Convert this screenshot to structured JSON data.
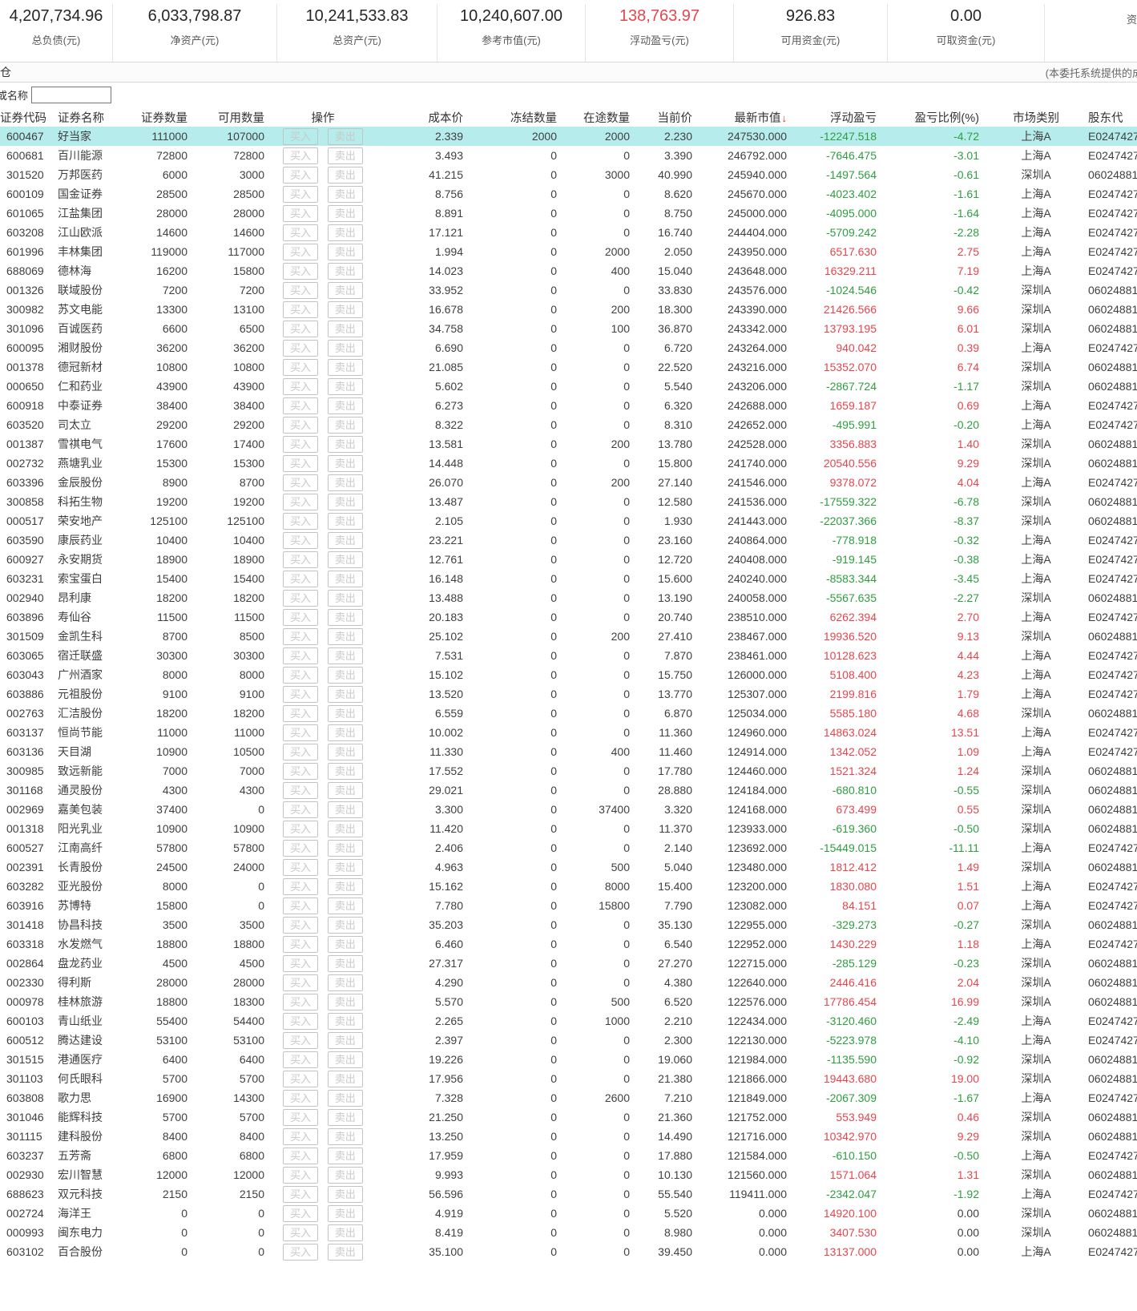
{
  "summary": {
    "items": [
      {
        "value": "4,207,734.96",
        "label": "总负债(元)"
      },
      {
        "value": "6,033,798.87",
        "label": "净资产(元)"
      },
      {
        "value": "10,241,533.83",
        "label": "总资产(元)"
      },
      {
        "value": "10,240,607.00",
        "label": "参考市值(元)"
      },
      {
        "value": "138,763.97",
        "label": "浮动盈亏(元)",
        "color": "#e5464e"
      },
      {
        "value": "926.83",
        "label": "可用资金(元)"
      },
      {
        "value": "0.00",
        "label": "可取资金(元)"
      },
      {
        "value": "",
        "label": "资"
      }
    ]
  },
  "tabbar": {
    "tab_label": "仓",
    "system_note": "(本委托系统提供的成"
  },
  "filter": {
    "label_fragment": "或",
    "label": "名称",
    "value": "",
    "placeholder": ""
  },
  "table": {
    "columns": [
      "证券代码",
      "证券名称",
      "证券数量",
      "可用数量",
      "操作",
      "成本价",
      "冻结数量",
      "在途数量",
      "当前价",
      "最新市值",
      "浮动盈亏",
      "盈亏比例(%)",
      "市场类别",
      "股东代"
    ],
    "sort_icon": "↓",
    "op": {
      "buy_label": "买入",
      "sell_label": "卖出"
    },
    "selected_row_index": 0,
    "colors": {
      "positive": "#e5464e",
      "negative": "#2e9e41",
      "selected_row": "#b7ecec"
    },
    "rows": [
      [
        "600467",
        "好当家",
        "111000",
        "107000",
        "2.339",
        "2000",
        "2000",
        "2.230",
        "247530.000",
        "-12247.518",
        "-4.72",
        "上海A",
        "E0247427"
      ],
      [
        "600681",
        "百川能源",
        "72800",
        "72800",
        "3.493",
        "0",
        "0",
        "3.390",
        "246792.000",
        "-7646.475",
        "-3.01",
        "上海A",
        "E0247427"
      ],
      [
        "301520",
        "万邦医药",
        "6000",
        "3000",
        "41.215",
        "0",
        "3000",
        "40.990",
        "245940.000",
        "-1497.564",
        "-0.61",
        "深圳A",
        "06024881"
      ],
      [
        "600109",
        "国金证券",
        "28500",
        "28500",
        "8.756",
        "0",
        "0",
        "8.620",
        "245670.000",
        "-4023.402",
        "-1.61",
        "上海A",
        "E0247427"
      ],
      [
        "601065",
        "江盐集团",
        "28000",
        "28000",
        "8.891",
        "0",
        "0",
        "8.750",
        "245000.000",
        "-4095.000",
        "-1.64",
        "上海A",
        "E0247427"
      ],
      [
        "603208",
        "江山欧派",
        "14600",
        "14600",
        "17.121",
        "0",
        "0",
        "16.740",
        "244404.000",
        "-5709.242",
        "-2.28",
        "上海A",
        "E0247427"
      ],
      [
        "601996",
        "丰林集团",
        "119000",
        "117000",
        "1.994",
        "0",
        "2000",
        "2.050",
        "243950.000",
        "6517.630",
        "2.75",
        "上海A",
        "E0247427"
      ],
      [
        "688069",
        "德林海",
        "16200",
        "15800",
        "14.023",
        "0",
        "400",
        "15.040",
        "243648.000",
        "16329.211",
        "7.19",
        "上海A",
        "E0247427"
      ],
      [
        "001326",
        "联域股份",
        "7200",
        "7200",
        "33.952",
        "0",
        "0",
        "33.830",
        "243576.000",
        "-1024.546",
        "-0.42",
        "深圳A",
        "06024881"
      ],
      [
        "300982",
        "苏文电能",
        "13300",
        "13100",
        "16.678",
        "0",
        "200",
        "18.300",
        "243390.000",
        "21426.566",
        "9.66",
        "深圳A",
        "06024881"
      ],
      [
        "301096",
        "百诚医药",
        "6600",
        "6500",
        "34.758",
        "0",
        "100",
        "36.870",
        "243342.000",
        "13793.195",
        "6.01",
        "深圳A",
        "06024881"
      ],
      [
        "600095",
        "湘财股份",
        "36200",
        "36200",
        "6.690",
        "0",
        "0",
        "6.720",
        "243264.000",
        "940.042",
        "0.39",
        "上海A",
        "E0247427"
      ],
      [
        "001378",
        "德冠新材",
        "10800",
        "10800",
        "21.085",
        "0",
        "0",
        "22.520",
        "243216.000",
        "15352.070",
        "6.74",
        "深圳A",
        "06024881"
      ],
      [
        "000650",
        "仁和药业",
        "43900",
        "43900",
        "5.602",
        "0",
        "0",
        "5.540",
        "243206.000",
        "-2867.724",
        "-1.17",
        "深圳A",
        "06024881"
      ],
      [
        "600918",
        "中泰证券",
        "38400",
        "38400",
        "6.273",
        "0",
        "0",
        "6.320",
        "242688.000",
        "1659.187",
        "0.69",
        "上海A",
        "E0247427"
      ],
      [
        "603520",
        "司太立",
        "29200",
        "29200",
        "8.322",
        "0",
        "0",
        "8.310",
        "242652.000",
        "-495.991",
        "-0.20",
        "上海A",
        "E0247427"
      ],
      [
        "001387",
        "雪祺电气",
        "17600",
        "17400",
        "13.581",
        "0",
        "200",
        "13.780",
        "242528.000",
        "3356.883",
        "1.40",
        "深圳A",
        "06024881"
      ],
      [
        "002732",
        "燕塘乳业",
        "15300",
        "15300",
        "14.448",
        "0",
        "0",
        "15.800",
        "241740.000",
        "20540.556",
        "9.29",
        "深圳A",
        "06024881"
      ],
      [
        "603396",
        "金辰股份",
        "8900",
        "8700",
        "26.070",
        "0",
        "200",
        "27.140",
        "241546.000",
        "9378.072",
        "4.04",
        "上海A",
        "E0247427"
      ],
      [
        "300858",
        "科拓生物",
        "19200",
        "19200",
        "13.487",
        "0",
        "0",
        "12.580",
        "241536.000",
        "-17559.322",
        "-6.78",
        "深圳A",
        "06024881"
      ],
      [
        "000517",
        "荣安地产",
        "125100",
        "125100",
        "2.105",
        "0",
        "0",
        "1.930",
        "241443.000",
        "-22037.366",
        "-8.37",
        "深圳A",
        "06024881"
      ],
      [
        "603590",
        "康辰药业",
        "10400",
        "10400",
        "23.221",
        "0",
        "0",
        "23.160",
        "240864.000",
        "-778.918",
        "-0.32",
        "上海A",
        "E0247427"
      ],
      [
        "600927",
        "永安期货",
        "18900",
        "18900",
        "12.761",
        "0",
        "0",
        "12.720",
        "240408.000",
        "-919.145",
        "-0.38",
        "上海A",
        "E0247427"
      ],
      [
        "603231",
        "索宝蛋白",
        "15400",
        "15400",
        "16.148",
        "0",
        "0",
        "15.600",
        "240240.000",
        "-8583.344",
        "-3.45",
        "上海A",
        "E0247427"
      ],
      [
        "002940",
        "昂利康",
        "18200",
        "18200",
        "13.488",
        "0",
        "0",
        "13.190",
        "240058.000",
        "-5567.635",
        "-2.27",
        "深圳A",
        "06024881"
      ],
      [
        "603896",
        "寿仙谷",
        "11500",
        "11500",
        "20.183",
        "0",
        "0",
        "20.740",
        "238510.000",
        "6262.394",
        "2.70",
        "上海A",
        "E0247427"
      ],
      [
        "301509",
        "金凯生科",
        "8700",
        "8500",
        "25.102",
        "0",
        "200",
        "27.410",
        "238467.000",
        "19936.520",
        "9.13",
        "深圳A",
        "06024881"
      ],
      [
        "603065",
        "宿迁联盛",
        "30300",
        "30300",
        "7.531",
        "0",
        "0",
        "7.870",
        "238461.000",
        "10128.623",
        "4.44",
        "上海A",
        "E0247427"
      ],
      [
        "603043",
        "广州酒家",
        "8000",
        "8000",
        "15.102",
        "0",
        "0",
        "15.750",
        "126000.000",
        "5108.400",
        "4.23",
        "上海A",
        "E0247427"
      ],
      [
        "603886",
        "元祖股份",
        "9100",
        "9100",
        "13.520",
        "0",
        "0",
        "13.770",
        "125307.000",
        "2199.816",
        "1.79",
        "上海A",
        "E0247427"
      ],
      [
        "002763",
        "汇洁股份",
        "18200",
        "18200",
        "6.559",
        "0",
        "0",
        "6.870",
        "125034.000",
        "5585.180",
        "4.68",
        "深圳A",
        "06024881"
      ],
      [
        "603137",
        "恒尚节能",
        "11000",
        "11000",
        "10.002",
        "0",
        "0",
        "11.360",
        "124960.000",
        "14863.024",
        "13.51",
        "上海A",
        "E0247427"
      ],
      [
        "603136",
        "天目湖",
        "10900",
        "10500",
        "11.330",
        "0",
        "400",
        "11.460",
        "124914.000",
        "1342.052",
        "1.09",
        "上海A",
        "E0247427"
      ],
      [
        "300985",
        "致远新能",
        "7000",
        "7000",
        "17.552",
        "0",
        "0",
        "17.780",
        "124460.000",
        "1521.324",
        "1.24",
        "深圳A",
        "06024881"
      ],
      [
        "301168",
        "通灵股份",
        "4300",
        "4300",
        "29.021",
        "0",
        "0",
        "28.880",
        "124184.000",
        "-680.810",
        "-0.55",
        "深圳A",
        "06024881"
      ],
      [
        "002969",
        "嘉美包装",
        "37400",
        "0",
        "3.300",
        "0",
        "37400",
        "3.320",
        "124168.000",
        "673.499",
        "0.55",
        "深圳A",
        "06024881"
      ],
      [
        "001318",
        "阳光乳业",
        "10900",
        "10900",
        "11.420",
        "0",
        "0",
        "11.370",
        "123933.000",
        "-619.360",
        "-0.50",
        "深圳A",
        "06024881"
      ],
      [
        "600527",
        "江南高纤",
        "57800",
        "57800",
        "2.406",
        "0",
        "0",
        "2.140",
        "123692.000",
        "-15449.015",
        "-11.11",
        "上海A",
        "E0247427"
      ],
      [
        "002391",
        "长青股份",
        "24500",
        "24000",
        "4.963",
        "0",
        "500",
        "5.040",
        "123480.000",
        "1812.412",
        "1.49",
        "深圳A",
        "06024881"
      ],
      [
        "603282",
        "亚光股份",
        "8000",
        "0",
        "15.162",
        "0",
        "8000",
        "15.400",
        "123200.000",
        "1830.080",
        "1.51",
        "上海A",
        "E0247427"
      ],
      [
        "603916",
        "苏博特",
        "15800",
        "0",
        "7.780",
        "0",
        "15800",
        "7.790",
        "123082.000",
        "84.151",
        "0.07",
        "上海A",
        "E0247427"
      ],
      [
        "301418",
        "协昌科技",
        "3500",
        "3500",
        "35.203",
        "0",
        "0",
        "35.130",
        "122955.000",
        "-329.273",
        "-0.27",
        "深圳A",
        "06024881"
      ],
      [
        "603318",
        "水发燃气",
        "18800",
        "18800",
        "6.460",
        "0",
        "0",
        "6.540",
        "122952.000",
        "1430.229",
        "1.18",
        "上海A",
        "E0247427"
      ],
      [
        "002864",
        "盘龙药业",
        "4500",
        "4500",
        "27.317",
        "0",
        "0",
        "27.270",
        "122715.000",
        "-285.129",
        "-0.23",
        "深圳A",
        "06024881"
      ],
      [
        "002330",
        "得利斯",
        "28000",
        "28000",
        "4.290",
        "0",
        "0",
        "4.380",
        "122640.000",
        "2446.416",
        "2.04",
        "深圳A",
        "06024881"
      ],
      [
        "000978",
        "桂林旅游",
        "18800",
        "18300",
        "5.570",
        "0",
        "500",
        "6.520",
        "122576.000",
        "17786.454",
        "16.99",
        "深圳A",
        "06024881"
      ],
      [
        "600103",
        "青山纸业",
        "55400",
        "54400",
        "2.265",
        "0",
        "1000",
        "2.210",
        "122434.000",
        "-3120.460",
        "-2.49",
        "上海A",
        "E0247427"
      ],
      [
        "600512",
        "腾达建设",
        "53100",
        "53100",
        "2.397",
        "0",
        "0",
        "2.300",
        "122130.000",
        "-5223.978",
        "-4.10",
        "上海A",
        "E0247427"
      ],
      [
        "301515",
        "港通医疗",
        "6400",
        "6400",
        "19.226",
        "0",
        "0",
        "19.060",
        "121984.000",
        "-1135.590",
        "-0.92",
        "深圳A",
        "06024881"
      ],
      [
        "301103",
        "何氏眼科",
        "5700",
        "5700",
        "17.956",
        "0",
        "0",
        "21.380",
        "121866.000",
        "19443.680",
        "19.00",
        "深圳A",
        "06024881"
      ],
      [
        "603808",
        "歌力思",
        "16900",
        "14300",
        "7.328",
        "0",
        "2600",
        "7.210",
        "121849.000",
        "-2067.309",
        "-1.67",
        "上海A",
        "E0247427"
      ],
      [
        "301046",
        "能辉科技",
        "5700",
        "5700",
        "21.250",
        "0",
        "0",
        "21.360",
        "121752.000",
        "553.949",
        "0.46",
        "深圳A",
        "06024881"
      ],
      [
        "301115",
        "建科股份",
        "8400",
        "8400",
        "13.250",
        "0",
        "0",
        "14.490",
        "121716.000",
        "10342.970",
        "9.29",
        "深圳A",
        "06024881"
      ],
      [
        "603237",
        "五芳斋",
        "6800",
        "6800",
        "17.959",
        "0",
        "0",
        "17.880",
        "121584.000",
        "-610.150",
        "-0.50",
        "上海A",
        "E0247427"
      ],
      [
        "002930",
        "宏川智慧",
        "12000",
        "12000",
        "9.993",
        "0",
        "0",
        "10.130",
        "121560.000",
        "1571.064",
        "1.31",
        "深圳A",
        "06024881"
      ],
      [
        "688623",
        "双元科技",
        "2150",
        "2150",
        "56.596",
        "0",
        "0",
        "55.540",
        "119411.000",
        "-2342.047",
        "-1.92",
        "上海A",
        "E0247427"
      ],
      [
        "002724",
        "海洋王",
        "0",
        "0",
        "4.919",
        "0",
        "0",
        "5.520",
        "0.000",
        "14920.100",
        "0.00",
        "深圳A",
        "06024881"
      ],
      [
        "000993",
        "闽东电力",
        "0",
        "0",
        "8.419",
        "0",
        "0",
        "8.980",
        "0.000",
        "3407.530",
        "0.00",
        "深圳A",
        "06024881"
      ],
      [
        "603102",
        "百合股份",
        "0",
        "0",
        "35.100",
        "0",
        "0",
        "39.450",
        "0.000",
        "13137.000",
        "0.00",
        "上海A",
        "E0247427"
      ]
    ]
  }
}
